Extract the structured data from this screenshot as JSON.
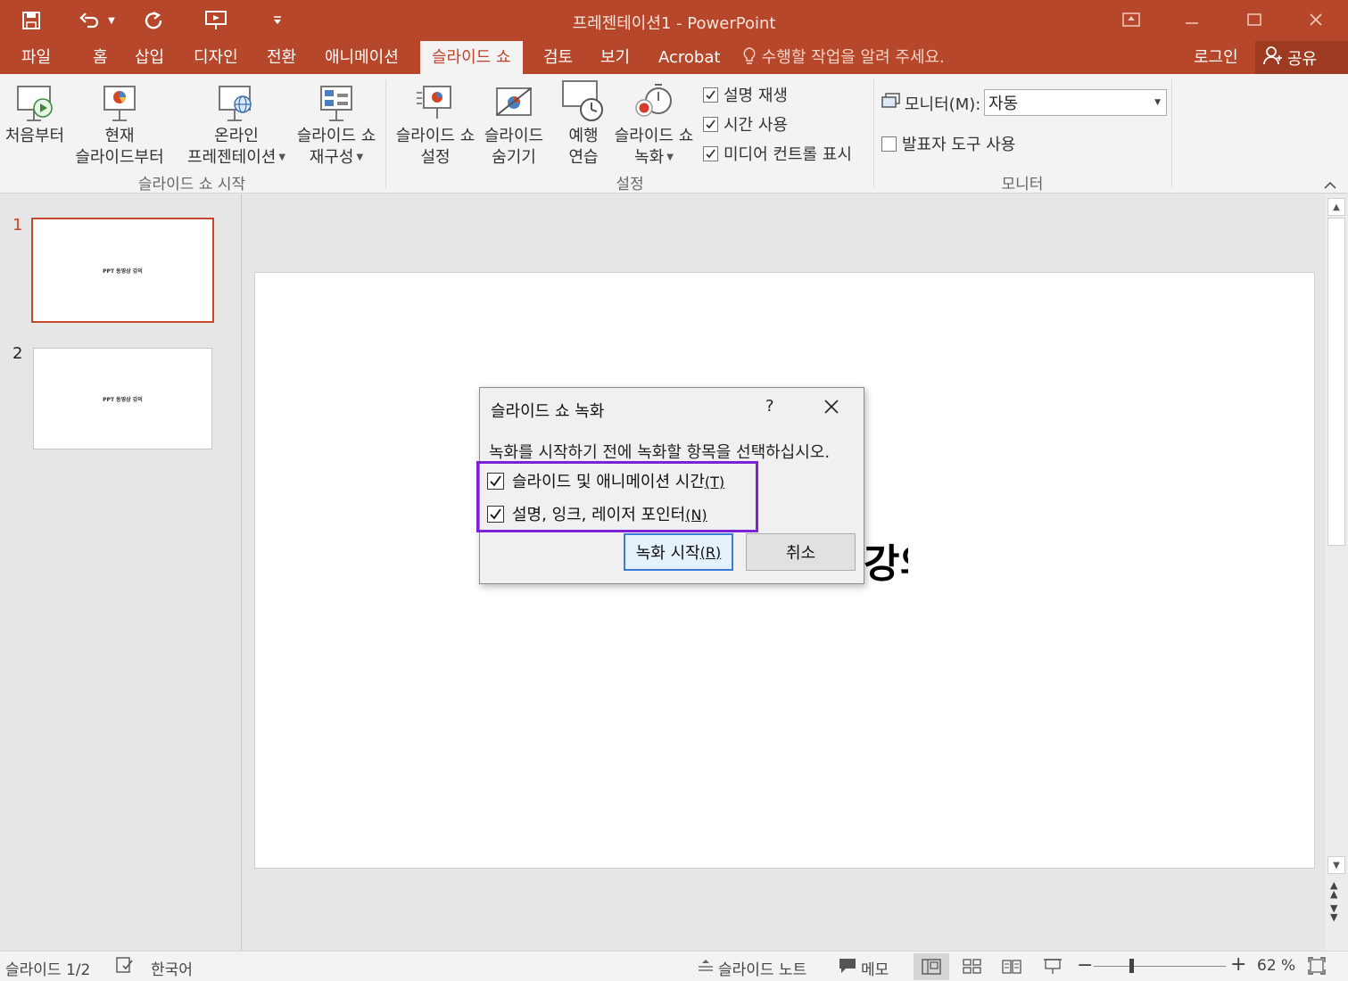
{
  "window": {
    "title": "프레젠테이션1 - PowerPoint"
  },
  "tabs": [
    {
      "label": "파일"
    },
    {
      "label": "홈"
    },
    {
      "label": "삽입"
    },
    {
      "label": "디자인"
    },
    {
      "label": "전환"
    },
    {
      "label": "애니메이션"
    },
    {
      "label": "슬라이드 쇼"
    },
    {
      "label": "검토"
    },
    {
      "label": "보기"
    },
    {
      "label": "Acrobat"
    }
  ],
  "tell_me": "수행할 작업을 알려 주세요.",
  "login": "로그인",
  "share": "공유",
  "ribbon": {
    "start_group": {
      "label": "슬라이드 쇼 시작",
      "from_beginning": "처음부터",
      "from_current_1": "현재",
      "from_current_2": "슬라이드부터",
      "online_1": "온라인",
      "online_2": "프레젠테이션",
      "custom_1": "슬라이드 쇼",
      "custom_2": "재구성"
    },
    "setup_group": {
      "label": "설정",
      "setup_1": "슬라이드 쇼",
      "setup_2": "설정",
      "hide_1": "슬라이드",
      "hide_2": "숨기기",
      "rehearse_1": "예행",
      "rehearse_2": "연습",
      "record_1": "슬라이드 쇼",
      "record_2": "녹화",
      "play_narrations": "설명 재생",
      "use_timings": "시간 사용",
      "show_media_controls": "미디어 컨트롤 표시"
    },
    "monitor_group": {
      "label": "모니터",
      "monitor_label": "모니터(M):",
      "monitor_value": "자동",
      "presenter_view": "발표자 도구 사용"
    }
  },
  "thumbnails": [
    {
      "number": "1",
      "text": "PPT 동영상 강의"
    },
    {
      "number": "2",
      "text": "PPT 동영상 강의"
    }
  ],
  "slide": {
    "visible_text": "강의"
  },
  "dialog": {
    "title": "슬라이드 쇼 녹화",
    "help": "?",
    "prompt": "녹화를 시작하기 전에 녹화할 항목을 선택하십시오.",
    "option1": "슬라이드 및 애니메이션 시간",
    "option1_key": "(T)",
    "option2": "설명, 잉크, 레이저 포인터",
    "option2_key": "(N)",
    "start_label": "녹화 시작",
    "start_key": "(R)",
    "cancel_label": "취소"
  },
  "status": {
    "slide_count": "슬라이드 1/2",
    "language": "한국어",
    "notes": "슬라이드 노트",
    "comments": "메모",
    "zoom": "62 %"
  },
  "colors": {
    "accent": "#b7472a",
    "highlight": "#7b22d6"
  }
}
